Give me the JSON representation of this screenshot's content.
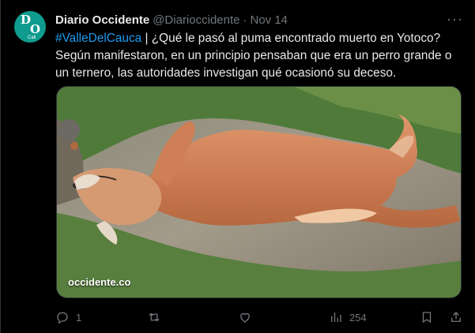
{
  "author": {
    "name": "Diario Occidente",
    "handle": "@Diarioccidente",
    "separator": "·",
    "time": "Nov 14",
    "avatar": {
      "l1": "D",
      "l2": "O",
      "l3": "Cali",
      "color": "#0f9b8e"
    }
  },
  "tweet": {
    "hashtag": "#ValleDelCauca",
    "text_line_1_rest": " | ¿Qué le pasó al puma encontrado muerto en Yotoco?",
    "text_rest": "Según manifestaron, en un principio pensaban que era un perro grande o un ternero, las autoridades investigan qué ocasionó su deceso."
  },
  "media": {
    "watermark": "occidente.co"
  },
  "actions": {
    "reply_count": "1",
    "retweet_count": "",
    "like_count": "",
    "views_count": "254"
  },
  "more_label": "···",
  "colors": {
    "background": "#000000",
    "text": "#e7e9ea",
    "muted": "#71767b",
    "link": "#1d9bf0"
  },
  "icons": [
    "reply-icon",
    "retweet-icon",
    "like-icon",
    "views-icon",
    "bookmark-icon",
    "share-icon",
    "more-icon"
  ]
}
